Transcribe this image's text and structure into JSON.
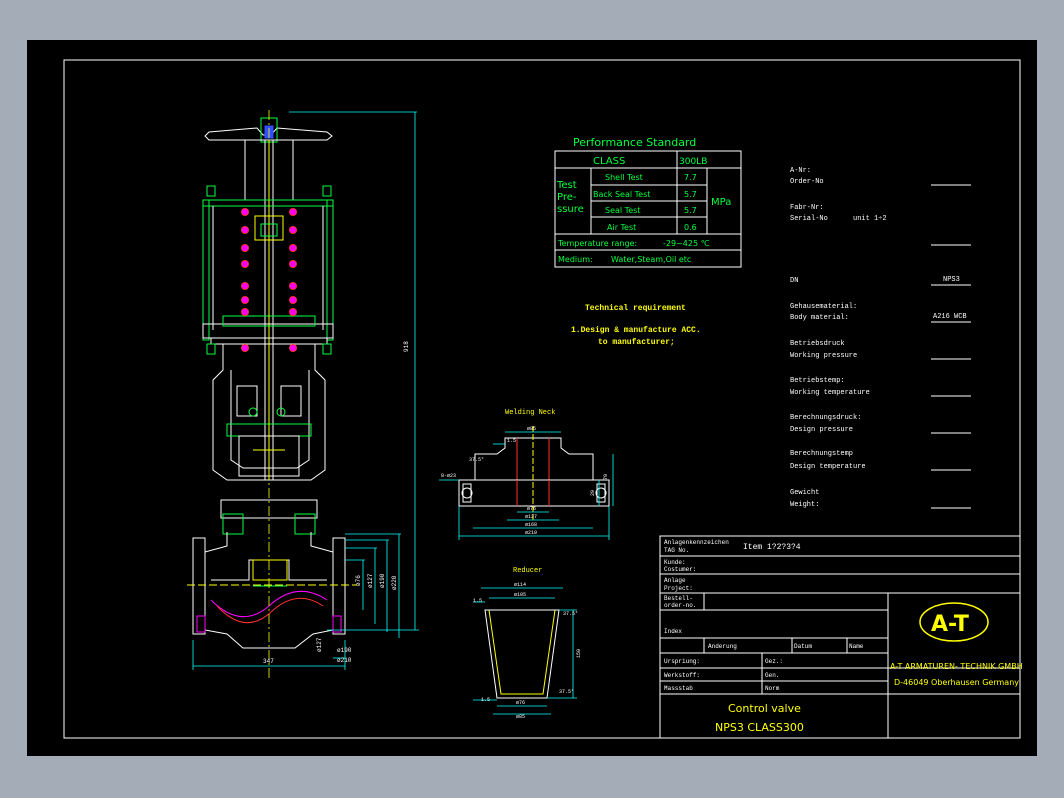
{
  "colors": {
    "background": "#a4acb8",
    "sheet": "#000000",
    "line_white": "#ffffff",
    "line_green": "#00ff40",
    "line_yellow": "#ffff00",
    "line_cyan": "#00ffff",
    "line_magenta": "#ff00ff",
    "line_blue": "#3050ff",
    "line_red": "#ff3030",
    "dimension": "#00ffff"
  },
  "performance": {
    "title": "Performance Standard",
    "class_label": "CLASS",
    "class_value": "300LB",
    "test_label_1": "Test",
    "test_label_2": "Pre-",
    "test_label_3": "ssure",
    "unit": "MPa",
    "rows": [
      {
        "name": "Shell Test",
        "value": "7.7"
      },
      {
        "name": "Back Seal Test",
        "value": "5.7"
      },
      {
        "name": "Seal Test",
        "value": "5.7"
      },
      {
        "name": "Air Test",
        "value": "0.6"
      }
    ],
    "temperature_label": "Temperature range:",
    "temperature_value": "-29~425 ℃",
    "medium_label": "Medium:",
    "medium_value": "Water,Steam,Oil etc"
  },
  "technical": {
    "title": "Technical requirement",
    "line1": "1.Design & manufacture ACC.",
    "line2": "to manufacturer;"
  },
  "details": {
    "welding_neck": "Welding Neck",
    "reducer": "Reducer"
  },
  "dims": {
    "height_total": "918",
    "d1": "ø220",
    "d2": "ø190",
    "d3": "ø127",
    "d4": "ø76",
    "face_to_face": "347",
    "d5": "ø127",
    "d6": "ø190",
    "d7": "ø210",
    "wn_top": "ø85",
    "wn_a": "1.5",
    "wn_b": "37.5°",
    "wn_c": "8-ø23",
    "wn_h": "79",
    "wn_h2": "29",
    "wn_d1": "ø76",
    "wn_d2": "ø127",
    "wn_d3": "ø168",
    "wn_d4": "ø210",
    "rd_top": "ø114",
    "rd_top2": "ø105",
    "rd_a": "1.5",
    "rd_angle": "37.5°",
    "rd_angle2": "37.5°",
    "rd_h": "150",
    "rd_bot": "ø76",
    "rd_bot2": "ø85"
  },
  "order_info": {
    "a_nr_de": "A-Nr:",
    "order_no": "Order-No",
    "fabr_nr_de": "Fabr-Nr:",
    "serial_no": "Serial-No",
    "unit_label": "unit 1÷2",
    "dn_label": "DN",
    "dn_value": "NPS3",
    "body_material_de": "Gehausematerial:",
    "body_material": "Body material:",
    "body_material_value": "A216 WCB",
    "working_pressure_de": "Betriebsdruck",
    "working_pressure": "Working pressure",
    "working_temp_de": "Betriebstemp:",
    "working_temp": "Working temperature",
    "design_pressure_de": "Berechnungsdruck:",
    "design_pressure": "Design pressure",
    "design_temp_de": "Berechnungstemp",
    "design_temp": "Design temperature",
    "weight_de": "Gewicht",
    "weight": "Weight:"
  },
  "title_block": {
    "tag_de": "Anlagenkennzeichen",
    "tag_en": "TAG No.",
    "item": "Item 1?2?3?4",
    "customer_de": "Kunde:",
    "customer_en": "Costumer:",
    "project_de": "Anlage",
    "project_en": "Project:",
    "order_de": "Bestell-",
    "order_en": "order-no.",
    "index": "Index",
    "change": "Anderung",
    "date": "Datum",
    "name": "Name",
    "drawing_de": "Urspriung:",
    "checked_de": "Werkstoff:",
    "scale_de": "Massstab",
    "drawn": "Gez.:",
    "approved": "Gen.",
    "norm": "Norm",
    "logo": "A-T",
    "company_line1": "A-T ARMATUREN- TECHNIK GMBH",
    "company_line2": "D-46049 Oberhausen Germany",
    "title_line1": "Control valve",
    "title_line2": "NPS3 CLASS300"
  }
}
